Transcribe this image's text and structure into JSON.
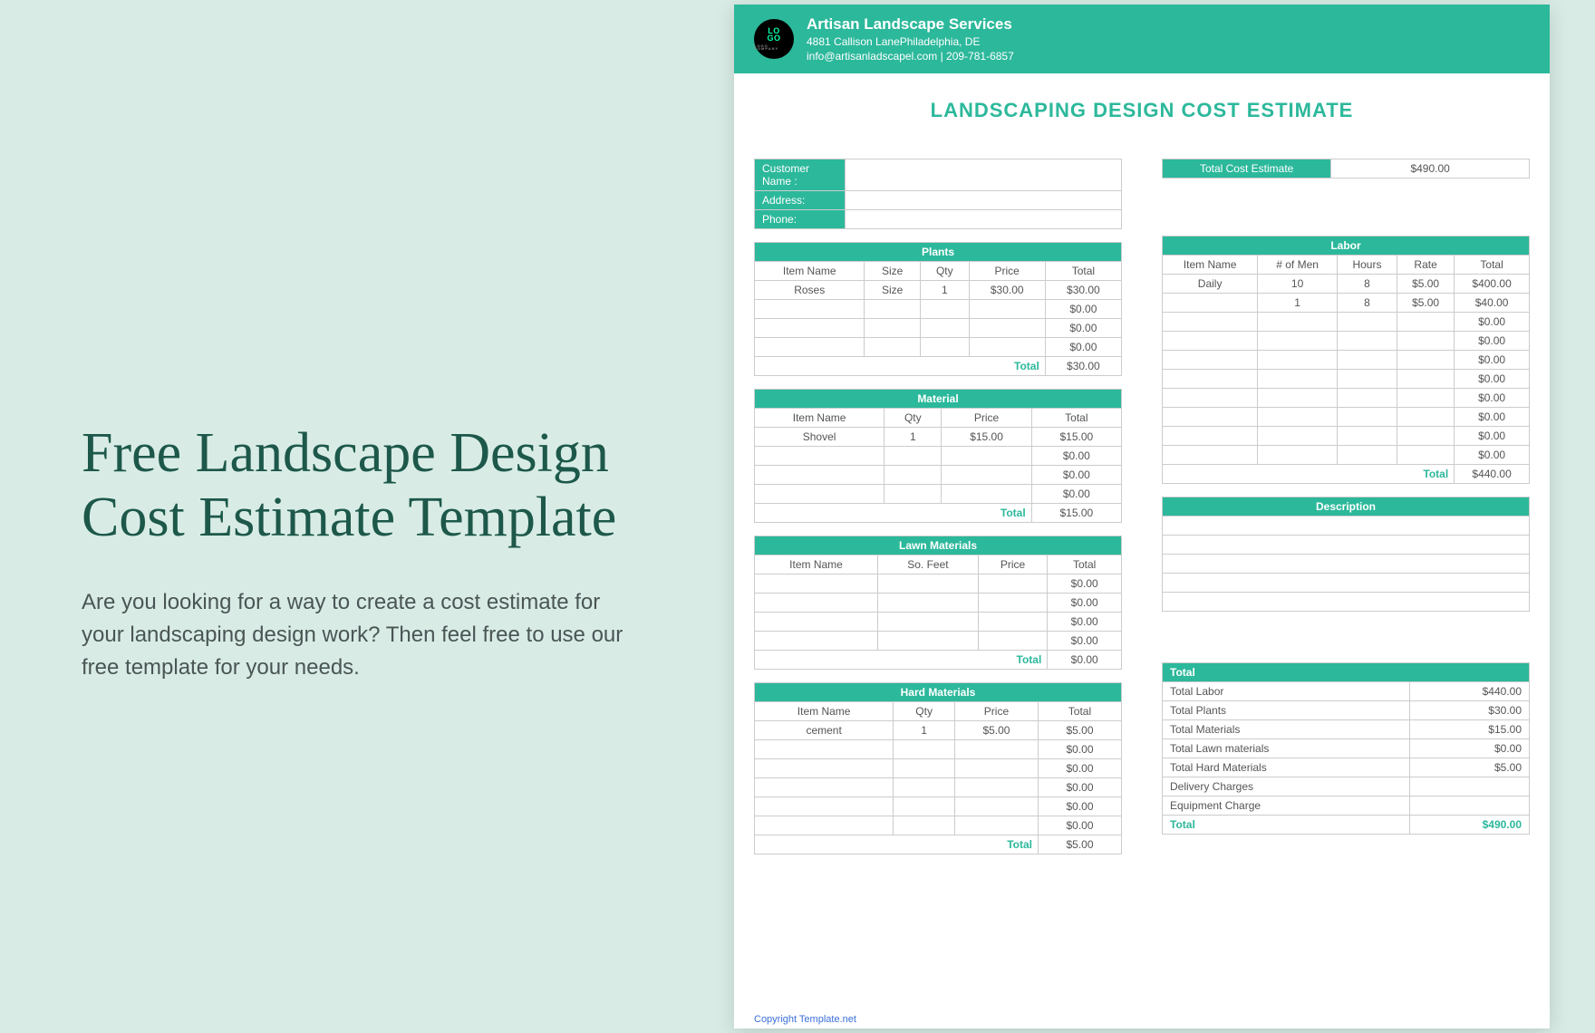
{
  "left": {
    "title": "Free Landscape Design Cost Estimate Template",
    "description": "Are you looking for a way to create a cost estimate for your landscaping design work? Then feel free to use our free template for your needs."
  },
  "company": {
    "logo_top": "LO",
    "logo_bottom": "GO",
    "logo_sub": "LOGO COMPANY",
    "name": "Artisan Landscape Services",
    "address": "4881 Callison LanePhiladelphia, DE",
    "contact": "info@artisanladscapel.com | 209-781-6857"
  },
  "doc_title": "LANDSCAPING DESIGN COST ESTIMATE",
  "customer": {
    "name_label": "Customer Name :",
    "address_label": "Address:",
    "phone_label": "Phone:"
  },
  "total_estimate": {
    "label": "Total Cost Estimate",
    "value": "$490.00"
  },
  "plants": {
    "header": "Plants",
    "cols": [
      "Item Name",
      "Size",
      "Qty",
      "Price",
      "Total"
    ],
    "rows": [
      [
        "Roses",
        "Size",
        "1",
        "$30.00",
        "$30.00"
      ],
      [
        "",
        "",
        "",
        "",
        "$0.00"
      ],
      [
        "",
        "",
        "",
        "",
        "$0.00"
      ],
      [
        "",
        "",
        "",
        "",
        "$0.00"
      ]
    ],
    "total_label": "Total",
    "total": "$30.00"
  },
  "material": {
    "header": "Material",
    "cols": [
      "Item Name",
      "Qty",
      "Price",
      "Total"
    ],
    "rows": [
      [
        "Shovel",
        "1",
        "$15.00",
        "$15.00"
      ],
      [
        "",
        "",
        "",
        "$0.00"
      ],
      [
        "",
        "",
        "",
        "$0.00"
      ],
      [
        "",
        "",
        "",
        "$0.00"
      ]
    ],
    "total_label": "Total",
    "total": "$15.00"
  },
  "lawn": {
    "header": "Lawn Materials",
    "cols": [
      "Item Name",
      "So. Feet",
      "Price",
      "Total"
    ],
    "rows": [
      [
        "",
        "",
        "",
        "$0.00"
      ],
      [
        "",
        "",
        "",
        "$0.00"
      ],
      [
        "",
        "",
        "",
        "$0.00"
      ],
      [
        "",
        "",
        "",
        "$0.00"
      ]
    ],
    "total_label": "Total",
    "total": "$0.00"
  },
  "hard": {
    "header": "Hard Materials",
    "cols": [
      "Item Name",
      "Qty",
      "Price",
      "Total"
    ],
    "rows": [
      [
        "cement",
        "1",
        "$5.00",
        "$5.00"
      ],
      [
        "",
        "",
        "",
        "$0.00"
      ],
      [
        "",
        "",
        "",
        "$0.00"
      ],
      [
        "",
        "",
        "",
        "$0.00"
      ],
      [
        "",
        "",
        "",
        "$0.00"
      ],
      [
        "",
        "",
        "",
        "$0.00"
      ]
    ],
    "total_label": "Total",
    "total": "$5.00"
  },
  "labor": {
    "header": "Labor",
    "cols": [
      "Item Name",
      "# of Men",
      "Hours",
      "Rate",
      "Total"
    ],
    "rows": [
      [
        "Daily",
        "10",
        "8",
        "$5.00",
        "$400.00"
      ],
      [
        "",
        "1",
        "8",
        "$5.00",
        "$40.00"
      ],
      [
        "",
        "",
        "",
        "",
        "$0.00"
      ],
      [
        "",
        "",
        "",
        "",
        "$0.00"
      ],
      [
        "",
        "",
        "",
        "",
        "$0.00"
      ],
      [
        "",
        "",
        "",
        "",
        "$0.00"
      ],
      [
        "",
        "",
        "",
        "",
        "$0.00"
      ],
      [
        "",
        "",
        "",
        "",
        "$0.00"
      ],
      [
        "",
        "",
        "",
        "",
        "$0.00"
      ],
      [
        "",
        "",
        "",
        "",
        "$0.00"
      ]
    ],
    "total_label": "Total",
    "total": "$440.00"
  },
  "description": {
    "header": "Description",
    "rows": [
      "",
      "",
      "",
      "",
      ""
    ]
  },
  "totals": {
    "header": "Total",
    "rows": [
      [
        "Total Labor",
        "$440.00"
      ],
      [
        "Total Plants",
        "$30.00"
      ],
      [
        "Total Materials",
        "$15.00"
      ],
      [
        "Total Lawn materials",
        "$0.00"
      ],
      [
        "Total Hard Materials",
        "$5.00"
      ],
      [
        "Delivery Charges",
        ""
      ],
      [
        "Equipment Charge",
        ""
      ]
    ],
    "grand_label": "Total",
    "grand": "$490.00"
  },
  "copyright": "Copyright Template.net"
}
